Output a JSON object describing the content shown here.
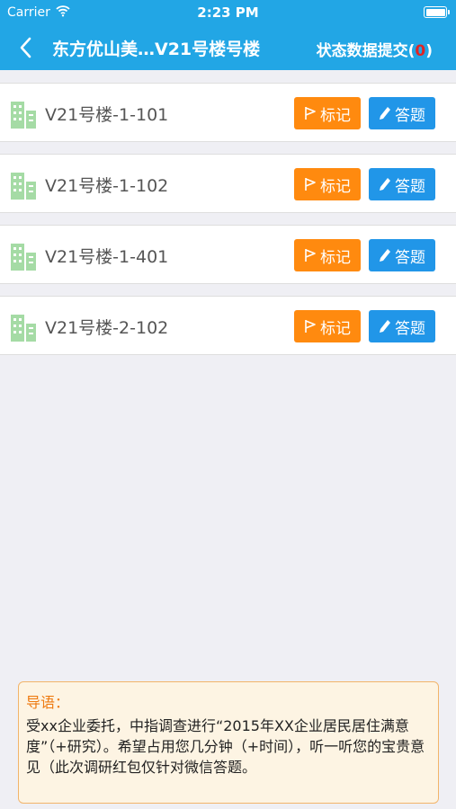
{
  "status_bar": {
    "carrier": "Carrier",
    "time": "2:23 PM"
  },
  "nav": {
    "title": "东方优山美…V21号楼号楼",
    "submit_label": "状态数据提交(",
    "submit_count": "0",
    "submit_close": ")"
  },
  "units": [
    {
      "name": "V21号楼-1-101",
      "mark_label": "标记",
      "answer_label": "答题"
    },
    {
      "name": "V21号楼-1-102",
      "mark_label": "标记",
      "answer_label": "答题"
    },
    {
      "name": "V21号楼-1-401",
      "mark_label": "标记",
      "answer_label": "答题"
    },
    {
      "name": "V21号楼-2-102",
      "mark_label": "标记",
      "answer_label": "答题"
    }
  ],
  "intro": {
    "heading": "导语：",
    "text": "受xx企业委托，中指调查进行“2015年XX企业居民居住满意度”（+研究）。希望占用您几分钟（+时间），听一听您的宝贵意见（此次调研红包仅针对微信答题。"
  },
  "colors": {
    "nav_bg": "#22a6e5",
    "mark_button": "#ff8a0f",
    "answer_button": "#2196e8",
    "count_red": "#e02424",
    "intro_heading": "#ee7a10",
    "building_icon": "#a5dba5"
  }
}
